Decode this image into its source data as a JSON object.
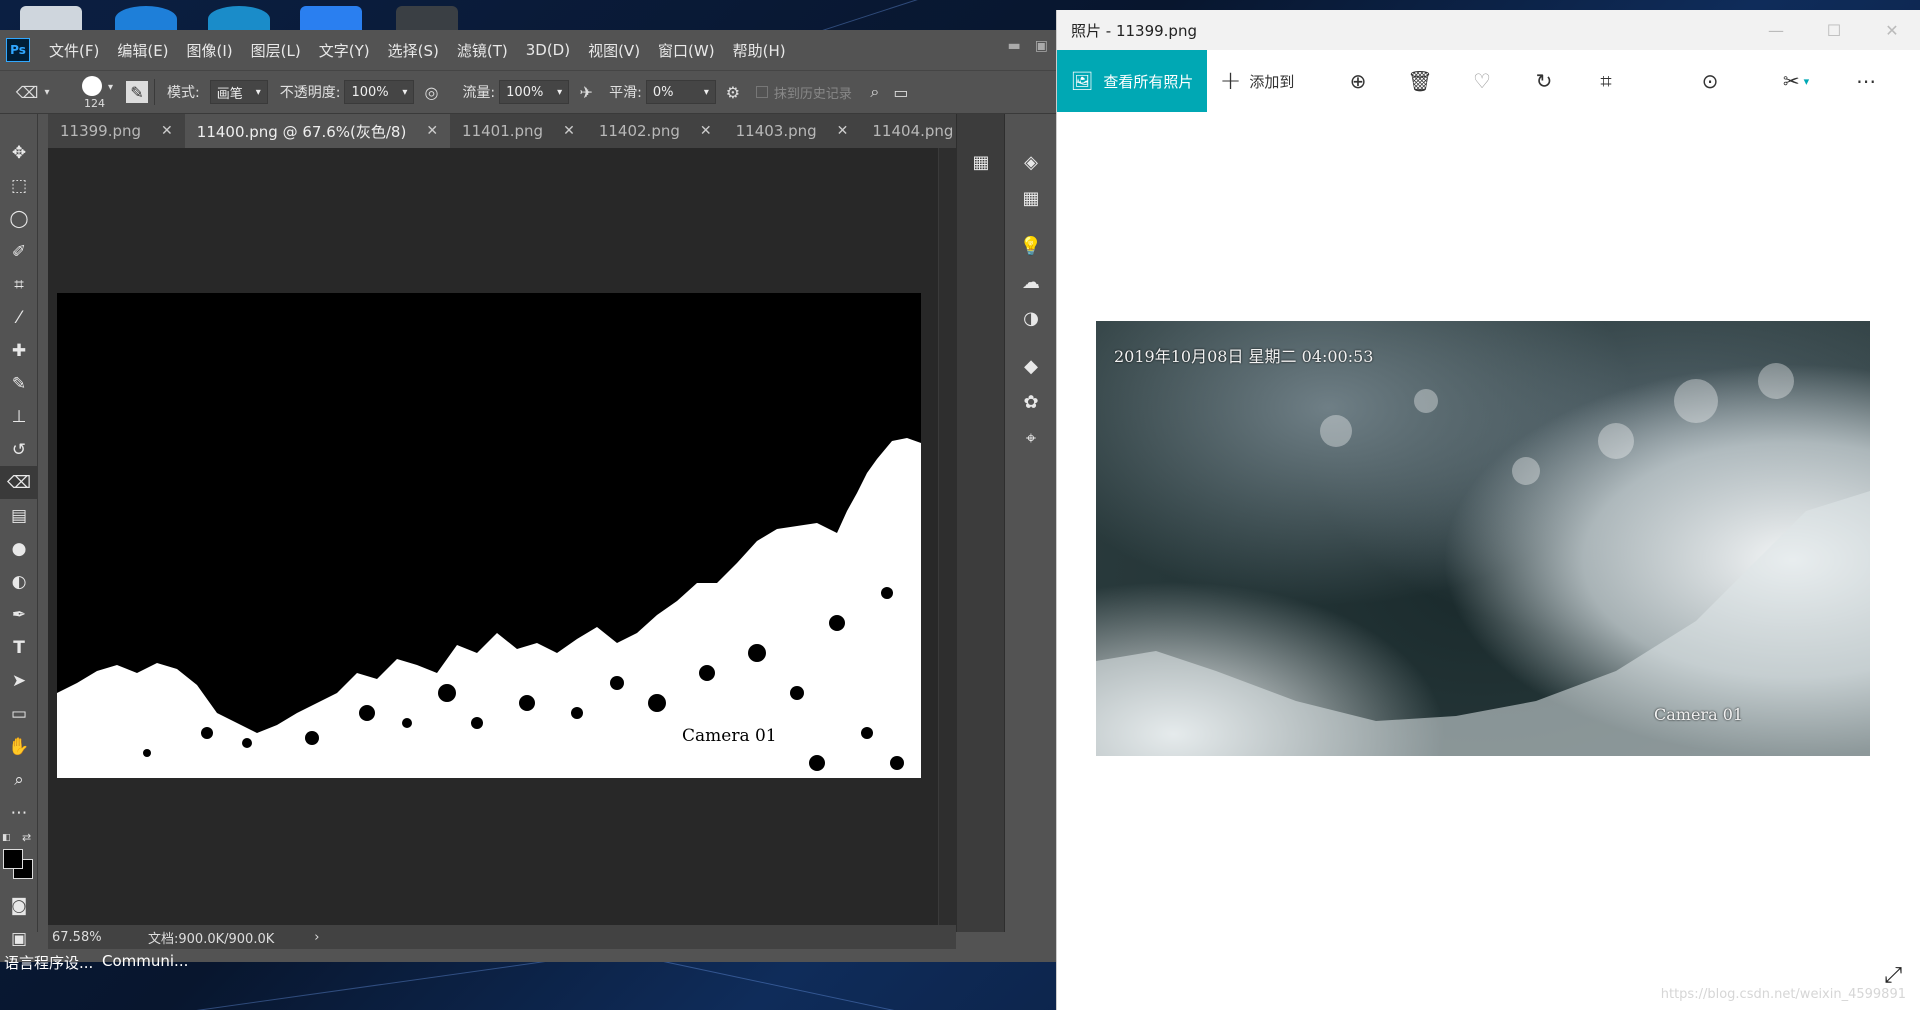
{
  "photoshop": {
    "logo": "Ps",
    "menu": [
      "文件(F)",
      "编辑(E)",
      "图像(I)",
      "图层(L)",
      "文字(Y)",
      "选择(S)",
      "滤镜(T)",
      "3D(D)",
      "视图(V)",
      "窗口(W)",
      "帮助(H)"
    ],
    "options": {
      "brush_size": "124",
      "mode_label": "模式:",
      "mode_value": "画笔",
      "opacity_label": "不透明度:",
      "opacity_value": "100%",
      "flow_label": "流量:",
      "flow_value": "100%",
      "smoothing_label": "平滑:",
      "smoothing_value": "0%",
      "erase_history_label": "抹到历史记录"
    },
    "tabs": [
      {
        "label": "11399.png",
        "active": false
      },
      {
        "label": "11400.png @ 67.6%(灰色/8)",
        "active": true
      },
      {
        "label": "11401.png",
        "active": false
      },
      {
        "label": "11402.png",
        "active": false
      },
      {
        "label": "11403.png",
        "active": false
      },
      {
        "label": "11404.png",
        "active": false
      }
    ],
    "canvas_overlay_text": "Camera 01",
    "status": {
      "zoom": "67.58%",
      "doc_size": "文档:900.0K/900.0K"
    }
  },
  "taskbar_strip": {
    "item1": "语言程序设...",
    "item2": "Communi..."
  },
  "photos": {
    "title": "照片 - 11399.png",
    "view_all_label": "查看所有照片",
    "add_to_label": "添加到",
    "image_timestamp": "2019年10月08日 星期二 04:00:53",
    "image_camera": "Camera 01",
    "watermark": "https://blog.csdn.net/weixin_4599891"
  },
  "colors": {
    "ps_bg": "#535353",
    "ps_canvas": "#282828",
    "photos_accent": "#00a8b4"
  }
}
